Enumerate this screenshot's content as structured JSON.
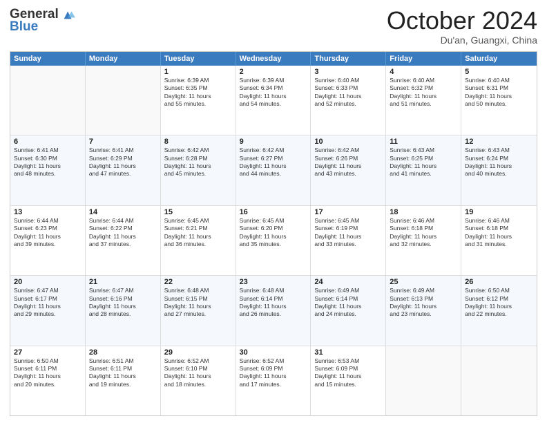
{
  "header": {
    "logo_general": "General",
    "logo_blue": "Blue",
    "title": "October 2024",
    "location": "Du'an, Guangxi, China"
  },
  "weekdays": [
    "Sunday",
    "Monday",
    "Tuesday",
    "Wednesday",
    "Thursday",
    "Friday",
    "Saturday"
  ],
  "rows": [
    [
      {
        "day": "",
        "sunrise": "",
        "sunset": "",
        "daylight": ""
      },
      {
        "day": "",
        "sunrise": "",
        "sunset": "",
        "daylight": ""
      },
      {
        "day": "1",
        "sunrise": "Sunrise: 6:39 AM",
        "sunset": "Sunset: 6:35 PM",
        "daylight": "Daylight: 11 hours and 55 minutes."
      },
      {
        "day": "2",
        "sunrise": "Sunrise: 6:39 AM",
        "sunset": "Sunset: 6:34 PM",
        "daylight": "Daylight: 11 hours and 54 minutes."
      },
      {
        "day": "3",
        "sunrise": "Sunrise: 6:40 AM",
        "sunset": "Sunset: 6:33 PM",
        "daylight": "Daylight: 11 hours and 52 minutes."
      },
      {
        "day": "4",
        "sunrise": "Sunrise: 6:40 AM",
        "sunset": "Sunset: 6:32 PM",
        "daylight": "Daylight: 11 hours and 51 minutes."
      },
      {
        "day": "5",
        "sunrise": "Sunrise: 6:40 AM",
        "sunset": "Sunset: 6:31 PM",
        "daylight": "Daylight: 11 hours and 50 minutes."
      }
    ],
    [
      {
        "day": "6",
        "sunrise": "Sunrise: 6:41 AM",
        "sunset": "Sunset: 6:30 PM",
        "daylight": "Daylight: 11 hours and 48 minutes."
      },
      {
        "day": "7",
        "sunrise": "Sunrise: 6:41 AM",
        "sunset": "Sunset: 6:29 PM",
        "daylight": "Daylight: 11 hours and 47 minutes."
      },
      {
        "day": "8",
        "sunrise": "Sunrise: 6:42 AM",
        "sunset": "Sunset: 6:28 PM",
        "daylight": "Daylight: 11 hours and 45 minutes."
      },
      {
        "day": "9",
        "sunrise": "Sunrise: 6:42 AM",
        "sunset": "Sunset: 6:27 PM",
        "daylight": "Daylight: 11 hours and 44 minutes."
      },
      {
        "day": "10",
        "sunrise": "Sunrise: 6:42 AM",
        "sunset": "Sunset: 6:26 PM",
        "daylight": "Daylight: 11 hours and 43 minutes."
      },
      {
        "day": "11",
        "sunrise": "Sunrise: 6:43 AM",
        "sunset": "Sunset: 6:25 PM",
        "daylight": "Daylight: 11 hours and 41 minutes."
      },
      {
        "day": "12",
        "sunrise": "Sunrise: 6:43 AM",
        "sunset": "Sunset: 6:24 PM",
        "daylight": "Daylight: 11 hours and 40 minutes."
      }
    ],
    [
      {
        "day": "13",
        "sunrise": "Sunrise: 6:44 AM",
        "sunset": "Sunset: 6:23 PM",
        "daylight": "Daylight: 11 hours and 39 minutes."
      },
      {
        "day": "14",
        "sunrise": "Sunrise: 6:44 AM",
        "sunset": "Sunset: 6:22 PM",
        "daylight": "Daylight: 11 hours and 37 minutes."
      },
      {
        "day": "15",
        "sunrise": "Sunrise: 6:45 AM",
        "sunset": "Sunset: 6:21 PM",
        "daylight": "Daylight: 11 hours and 36 minutes."
      },
      {
        "day": "16",
        "sunrise": "Sunrise: 6:45 AM",
        "sunset": "Sunset: 6:20 PM",
        "daylight": "Daylight: 11 hours and 35 minutes."
      },
      {
        "day": "17",
        "sunrise": "Sunrise: 6:45 AM",
        "sunset": "Sunset: 6:19 PM",
        "daylight": "Daylight: 11 hours and 33 minutes."
      },
      {
        "day": "18",
        "sunrise": "Sunrise: 6:46 AM",
        "sunset": "Sunset: 6:18 PM",
        "daylight": "Daylight: 11 hours and 32 minutes."
      },
      {
        "day": "19",
        "sunrise": "Sunrise: 6:46 AM",
        "sunset": "Sunset: 6:18 PM",
        "daylight": "Daylight: 11 hours and 31 minutes."
      }
    ],
    [
      {
        "day": "20",
        "sunrise": "Sunrise: 6:47 AM",
        "sunset": "Sunset: 6:17 PM",
        "daylight": "Daylight: 11 hours and 29 minutes."
      },
      {
        "day": "21",
        "sunrise": "Sunrise: 6:47 AM",
        "sunset": "Sunset: 6:16 PM",
        "daylight": "Daylight: 11 hours and 28 minutes."
      },
      {
        "day": "22",
        "sunrise": "Sunrise: 6:48 AM",
        "sunset": "Sunset: 6:15 PM",
        "daylight": "Daylight: 11 hours and 27 minutes."
      },
      {
        "day": "23",
        "sunrise": "Sunrise: 6:48 AM",
        "sunset": "Sunset: 6:14 PM",
        "daylight": "Daylight: 11 hours and 26 minutes."
      },
      {
        "day": "24",
        "sunrise": "Sunrise: 6:49 AM",
        "sunset": "Sunset: 6:14 PM",
        "daylight": "Daylight: 11 hours and 24 minutes."
      },
      {
        "day": "25",
        "sunrise": "Sunrise: 6:49 AM",
        "sunset": "Sunset: 6:13 PM",
        "daylight": "Daylight: 11 hours and 23 minutes."
      },
      {
        "day": "26",
        "sunrise": "Sunrise: 6:50 AM",
        "sunset": "Sunset: 6:12 PM",
        "daylight": "Daylight: 11 hours and 22 minutes."
      }
    ],
    [
      {
        "day": "27",
        "sunrise": "Sunrise: 6:50 AM",
        "sunset": "Sunset: 6:11 PM",
        "daylight": "Daylight: 11 hours and 20 minutes."
      },
      {
        "day": "28",
        "sunrise": "Sunrise: 6:51 AM",
        "sunset": "Sunset: 6:11 PM",
        "daylight": "Daylight: 11 hours and 19 minutes."
      },
      {
        "day": "29",
        "sunrise": "Sunrise: 6:52 AM",
        "sunset": "Sunset: 6:10 PM",
        "daylight": "Daylight: 11 hours and 18 minutes."
      },
      {
        "day": "30",
        "sunrise": "Sunrise: 6:52 AM",
        "sunset": "Sunset: 6:09 PM",
        "daylight": "Daylight: 11 hours and 17 minutes."
      },
      {
        "day": "31",
        "sunrise": "Sunrise: 6:53 AM",
        "sunset": "Sunset: 6:09 PM",
        "daylight": "Daylight: 11 hours and 15 minutes."
      },
      {
        "day": "",
        "sunrise": "",
        "sunset": "",
        "daylight": ""
      },
      {
        "day": "",
        "sunrise": "",
        "sunset": "",
        "daylight": ""
      }
    ]
  ]
}
